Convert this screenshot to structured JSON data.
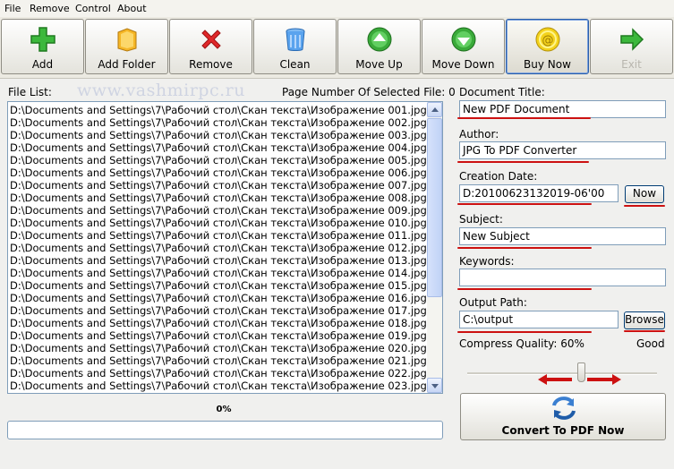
{
  "menu": [
    "File",
    "Remove",
    "Control",
    "About"
  ],
  "toolbar": [
    {
      "label": "Add",
      "icon": "plus-icon"
    },
    {
      "label": "Add Folder",
      "icon": "folder-icon"
    },
    {
      "label": "Remove",
      "icon": "delete-x-icon"
    },
    {
      "label": "Clean",
      "icon": "trash-bin-icon"
    },
    {
      "label": "Move Up",
      "icon": "arrow-up-circle-icon"
    },
    {
      "label": "Move Down",
      "icon": "arrow-down-circle-icon"
    },
    {
      "label": "Buy Now",
      "icon": "coin-icon"
    },
    {
      "label": "Exit",
      "icon": "exit-arrow-icon"
    }
  ],
  "watermark": "www.vashmirpc.ru",
  "file_list": {
    "label": "File List:",
    "selected_page_label": "Page Number Of Selected File: 0",
    "items": [
      "D:\\Documents and Settings\\7\\Рабочий стол\\Скан текста\\Изображение 001.jpg",
      "D:\\Documents and Settings\\7\\Рабочий стол\\Скан текста\\Изображение 002.jpg",
      "D:\\Documents and Settings\\7\\Рабочий стол\\Скан текста\\Изображение 003.jpg",
      "D:\\Documents and Settings\\7\\Рабочий стол\\Скан текста\\Изображение 004.jpg",
      "D:\\Documents and Settings\\7\\Рабочий стол\\Скан текста\\Изображение 005.jpg",
      "D:\\Documents and Settings\\7\\Рабочий стол\\Скан текста\\Изображение 006.jpg",
      "D:\\Documents and Settings\\7\\Рабочий стол\\Скан текста\\Изображение 007.jpg",
      "D:\\Documents and Settings\\7\\Рабочий стол\\Скан текста\\Изображение 008.jpg",
      "D:\\Documents and Settings\\7\\Рабочий стол\\Скан текста\\Изображение 009.jpg",
      "D:\\Documents and Settings\\7\\Рабочий стол\\Скан текста\\Изображение 010.jpg",
      "D:\\Documents and Settings\\7\\Рабочий стол\\Скан текста\\Изображение 011.jpg",
      "D:\\Documents and Settings\\7\\Рабочий стол\\Скан текста\\Изображение 012.jpg",
      "D:\\Documents and Settings\\7\\Рабочий стол\\Скан текста\\Изображение 013.jpg",
      "D:\\Documents and Settings\\7\\Рабочий стол\\Скан текста\\Изображение 014.jpg",
      "D:\\Documents and Settings\\7\\Рабочий стол\\Скан текста\\Изображение 015.jpg",
      "D:\\Documents and Settings\\7\\Рабочий стол\\Скан текста\\Изображение 016.jpg",
      "D:\\Documents and Settings\\7\\Рабочий стол\\Скан текста\\Изображение 017.jpg",
      "D:\\Documents and Settings\\7\\Рабочий стол\\Скан текста\\Изображение 018.jpg",
      "D:\\Documents and Settings\\7\\Рабочий стол\\Скан текста\\Изображение 019.jpg",
      "D:\\Documents and Settings\\7\\Рабочий стол\\Скан текста\\Изображение 020.jpg",
      "D:\\Documents and Settings\\7\\Рабочий стол\\Скан текста\\Изображение 021.jpg",
      "D:\\Documents and Settings\\7\\Рабочий стол\\Скан текста\\Изображение 022.jpg",
      "D:\\Documents and Settings\\7\\Рабочий стол\\Скан текста\\Изображение 023.jpg"
    ]
  },
  "progress": {
    "label": "0%",
    "value": 0
  },
  "document": {
    "title_label": "Document Title:",
    "title_value": "New PDF Document",
    "author_label": "Author:",
    "author_value": "JPG To PDF Converter",
    "date_label": "Creation Date:",
    "date_value": "D:20100623132019-06'00",
    "now_button": "Now",
    "subject_label": "Subject:",
    "subject_value": "New Subject",
    "keywords_label": "Keywords:",
    "keywords_value": "",
    "output_label": "Output Path:",
    "output_value": "C:\\output",
    "browse_button": "Browse",
    "quality_label": "Compress Quality: 60%",
    "quality_good": "Good",
    "quality_value": 0.6
  },
  "convert_button": "Convert To PDF Now",
  "colors": {
    "annotation": "#cc1111",
    "field_border": "#7f9db9"
  }
}
